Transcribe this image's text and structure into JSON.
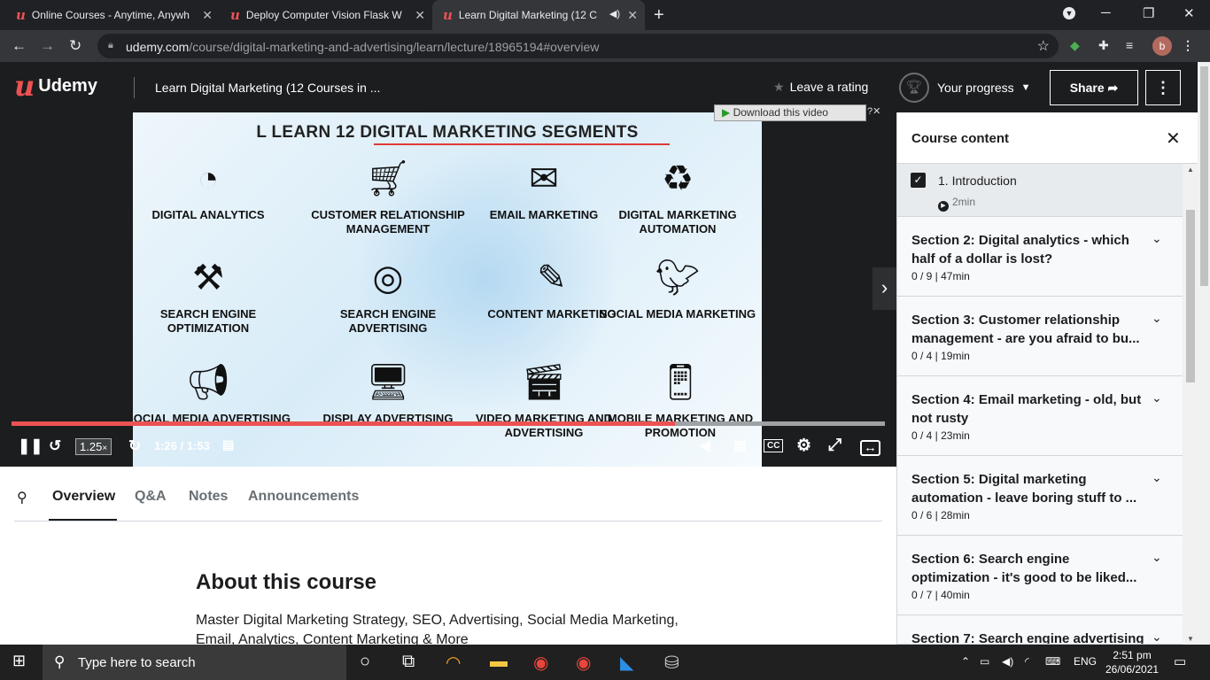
{
  "browser": {
    "tabs": [
      {
        "title": "Online Courses - Anytime, Anywh",
        "active": false
      },
      {
        "title": "Deploy Computer Vision Flask W",
        "active": false
      },
      {
        "title": "Learn Digital Marketing (12 C",
        "active": true
      }
    ],
    "url_host": "udemy.com",
    "url_path": "/course/digital-marketing-and-advertising/learn/lecture/18965194#overview",
    "avatar_letter": "b"
  },
  "header": {
    "brand": "Udemy",
    "course_title": "Learn Digital Marketing (12 Courses in ...",
    "rating_label": "Leave a rating",
    "progress_label": "Your progress",
    "share_label": "Share"
  },
  "video": {
    "slide_title": "L LEARN 12 DIGITAL MARKETING SEGMENTS",
    "segments": [
      {
        "label": "DIGITAL ANALYTICS",
        "icon": "pie-chart-icon"
      },
      {
        "label": "CUSTOMER RELATIONSHIP MANAGEMENT",
        "icon": "shopping-cart-icon"
      },
      {
        "label": "EMAIL MARKETING",
        "icon": "envelope-icon"
      },
      {
        "label": "DIGITAL MARKETING AUTOMATION",
        "icon": "recycle-icon"
      },
      {
        "label": "SEARCH ENGINE OPTIMIZATION",
        "icon": "tools-icon"
      },
      {
        "label": "SEARCH ENGINE ADVERTISING",
        "icon": "target-icon"
      },
      {
        "label": "CONTENT MARKETING",
        "icon": "pencil-icon"
      },
      {
        "label": "SOCIAL MEDIA MARKETING",
        "icon": "bird-icon"
      },
      {
        "label": "SOCIAL MEDIA ADVERTISING",
        "icon": "megaphone-icon"
      },
      {
        "label": "DISPLAY ADVERTISING",
        "icon": "monitor-icon"
      },
      {
        "label": "VIDEO MARKETING AND ADVERTISING",
        "icon": "clapper-icon"
      },
      {
        "label": "MOBILE MARKETING AND PROMOTION",
        "icon": "phone-icon"
      }
    ],
    "download_label": "Download this video",
    "speed": "1.25",
    "time": "1:26 / 1:53",
    "progress_fraction": 0.76
  },
  "lecture_tabs": [
    "Overview",
    "Q&A",
    "Notes",
    "Announcements"
  ],
  "overview": {
    "heading": "About this course",
    "description": "Master Digital Marketing Strategy, SEO, Advertising, Social Media Marketing, Email, Analytics, Content Marketing & More"
  },
  "sidebar": {
    "title": "Course content",
    "current_lecture": {
      "title": "1. Introduction",
      "duration": "2min"
    },
    "sections": [
      {
        "title": "Section 2: Digital analytics - which half of a dollar is lost?",
        "meta": "0 / 9 | 47min"
      },
      {
        "title": "Section 3: Customer relationship management - are you afraid to bu...",
        "meta": "0 / 4 | 19min"
      },
      {
        "title": "Section 4: Email marketing - old, but not rusty",
        "meta": "0 / 4 | 23min"
      },
      {
        "title": "Section 5: Digital marketing automation - leave boring stuff to ...",
        "meta": "0 / 6 | 28min"
      },
      {
        "title": "Section 6: Search engine optimization - it's good to be liked...",
        "meta": "0 / 7 | 40min"
      },
      {
        "title": "Section 7: Search engine advertising",
        "meta": ""
      }
    ]
  },
  "taskbar": {
    "search_placeholder": "Type here to search",
    "language": "ENG",
    "time": "2:51 pm",
    "date": "26/06/2021"
  }
}
